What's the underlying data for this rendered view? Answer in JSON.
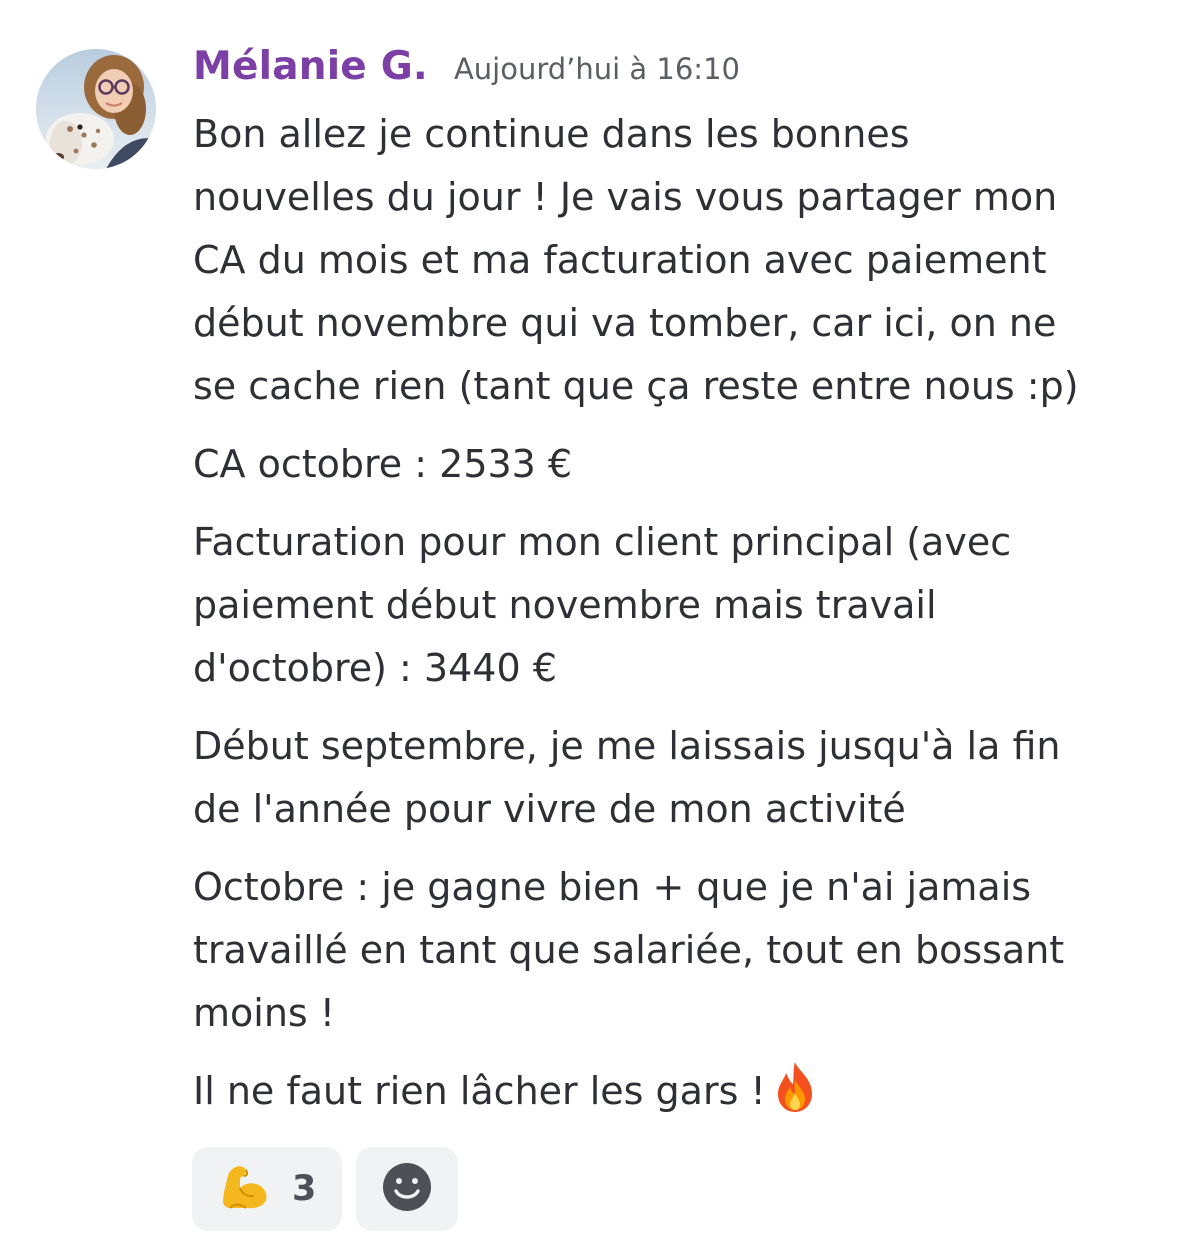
{
  "message": {
    "author": "Mélanie G.",
    "timestamp": "Aujourd’hui à 16:10",
    "paragraph1": [
      "Bon allez je continue dans les bonnes",
      "nouvelles du jour ! Je vais vous partager mon",
      "CA du mois et ma facturation avec paiement",
      "début novembre qui va tomber, car ici, on ne",
      "se cache rien (tant que ça reste entre nous :p)"
    ],
    "paragraph2": "CA octobre : 2533 €",
    "paragraph3": [
      "Facturation pour mon client principal (avec",
      "paiement début novembre mais travail",
      "d'octobre) : 3440 €"
    ],
    "paragraph4": [
      "Début septembre, je me laissais jusqu'à la fin",
      "de l'année pour vivre de mon activité"
    ],
    "paragraph5": [
      "Octobre : je gagne bien + que je n'ai jamais",
      "travaillé en tant que salariée, tout en bossant",
      "moins !"
    ],
    "paragraph6": "Il ne faut rien lâcher les gars !",
    "paragraph6_emoji": "fire-icon"
  },
  "reactions": [
    {
      "icon": "flexed-biceps-icon",
      "count": "3"
    },
    {
      "icon": "add-reaction-icon"
    }
  ],
  "colors": {
    "author": "#7b3fa6",
    "text": "#2e3035",
    "timestamp": "#5c5e66",
    "reaction_bg": "#f1f2f4"
  }
}
